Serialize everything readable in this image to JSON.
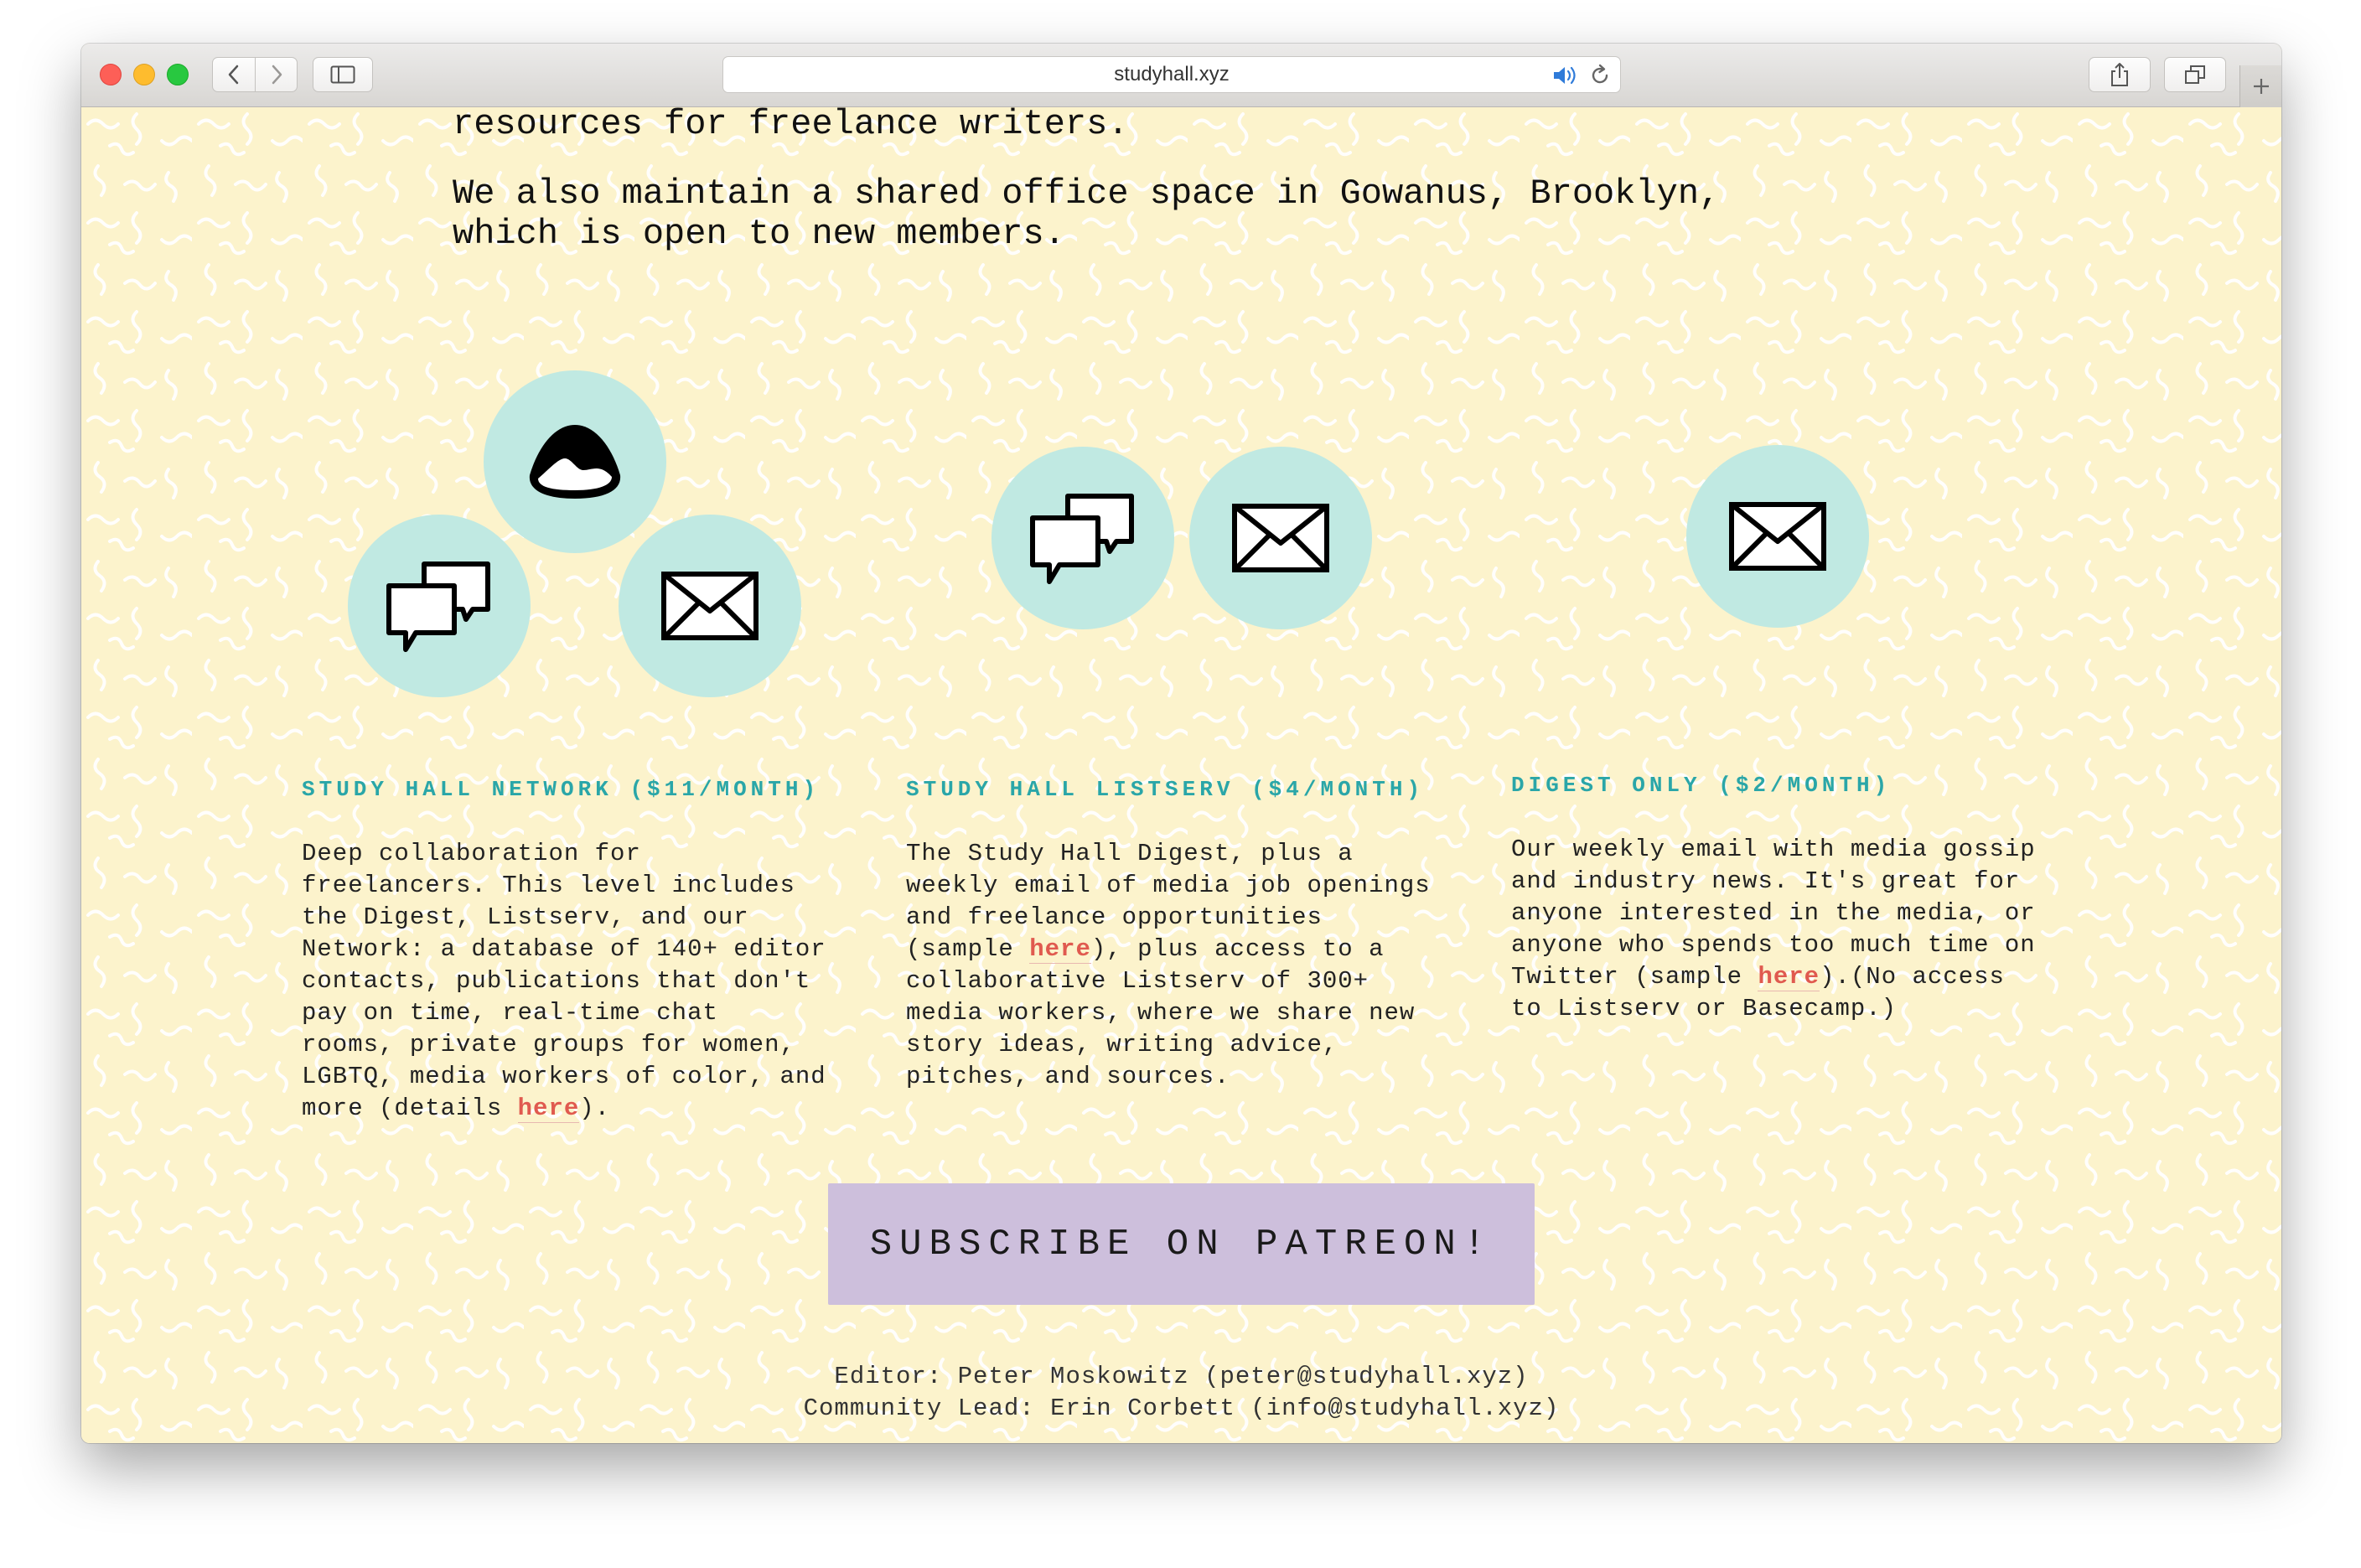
{
  "browser": {
    "url": "studyhall.xyz",
    "icons": {
      "back": "chevron-left-icon",
      "forward": "chevron-right-icon",
      "sidebar": "sidebar-icon",
      "audio": "speaker-icon",
      "reload": "reload-icon",
      "share": "share-icon",
      "tabs": "tabs-overview-icon",
      "new_tab": "plus-icon"
    }
  },
  "intro": {
    "line1": "resources for freelance writers.",
    "line2a": "We also maintain a shared office space in Gowanus, Brooklyn,",
    "line2b": "which is open to new members."
  },
  "tiers": [
    {
      "title": "STUDY HALL NETWORK ($11/MONTH)",
      "icons": [
        "basecamp-icon",
        "chat-bubbles-icon",
        "envelope-icon"
      ],
      "desc_before": "Deep collaboration for\nfreelancers. This level includes\nthe Digest, Listserv, and our\nNetwork: a database of 140+ editor\ncontacts, publications that don't\npay on time, real-time chat\nrooms, private groups for women,\nLGBTQ, media workers of color, and\nmore (details ",
      "link": "here",
      "desc_after": ")."
    },
    {
      "title": "STUDY HALL LISTSERV ($4/MONTH)",
      "icons": [
        "chat-bubbles-icon",
        "envelope-icon"
      ],
      "desc_before": "The Study Hall Digest, plus a\nweekly email of media job openings\nand freelance opportunities\n(sample ",
      "link": "here",
      "desc_after": "), plus access to a\ncollaborative Listserv of 300+\nmedia workers, where we share new\nstory ideas, writing advice,\npitches, and sources."
    },
    {
      "title": "DIGEST ONLY ($2/MONTH)",
      "icons": [
        "envelope-icon"
      ],
      "desc_before": "Our weekly email with media gossip\nand industry news. It's great for\nanyone interested in the media, or\nanyone who spends too much time on\nTwitter (sample ",
      "link": "here",
      "desc_after": ").(No access\nto Listserv or Basecamp.)"
    }
  ],
  "cta": {
    "label": "SUBSCRIBE ON PATREON!"
  },
  "footer": {
    "editor": "Editor: Peter Moskowitz (peter@studyhall.xyz)",
    "community": "Community Lead: Erin Corbett (info@studyhall.xyz)"
  },
  "colors": {
    "background": "#fcf3cc",
    "squiggle": "#ffffff",
    "icon_circle": "#c0e9e2",
    "tier_title": "#2aa6a8",
    "link": "#e05a4f",
    "cta_background": "#cdbfdc"
  }
}
